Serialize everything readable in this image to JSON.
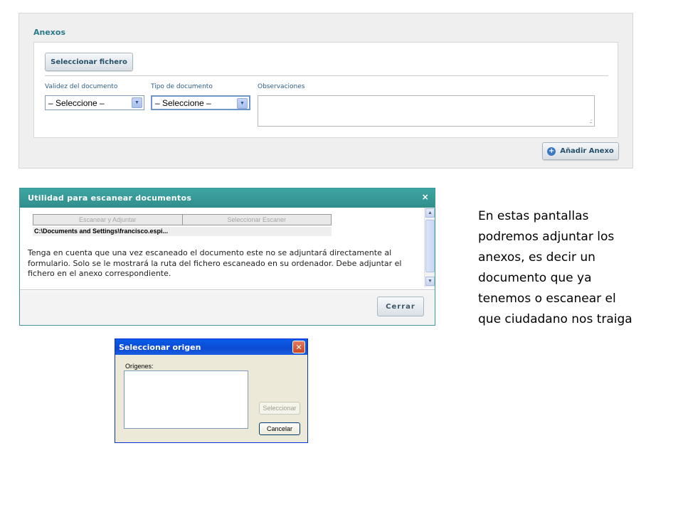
{
  "anexos": {
    "title": "Anexos",
    "select_file_button": "Seleccionar fichero",
    "validez_label": "Validez del documento",
    "validez_value": "– Seleccione –",
    "tipo_label": "Tipo de documento",
    "tipo_value": "– Seleccione –",
    "observaciones_label": "Observaciones",
    "observaciones_value": "",
    "add_button": "Añadir Anexo",
    "add_icon": "plus-circle-icon"
  },
  "scanner": {
    "title": "Utilidad para escanear documentos",
    "close_glyph": "×",
    "tab_scan": "Escanear y Adjuntar",
    "tab_select": "Seleccionar Escaner",
    "path": "C:\\Documents and Settings\\francisco.espi...",
    "note": "Tenga en cuenta que una vez escaneado el documento este no se adjuntará directamente al formulario. Solo se le mostrará la ruta del fichero escaneado en su ordenador. Debe adjuntar el fichero en el anexo correspondiente.",
    "close_button": "Cerrar"
  },
  "origen": {
    "title": "Seleccionar origen",
    "origenes_label": "Orígenes:",
    "select_button": "Seleccionar",
    "cancel_button": "Cancelar"
  },
  "side_text": "En estas pantallas podremos adjuntar los anexos, es decir un documento que ya tenemos o escanear el que ciudadano nos traiga",
  "colors": {
    "accent_teal": "#3fa6a3",
    "label_blue": "#2e5f87",
    "xp_title_blue": "#0a5ce8"
  }
}
